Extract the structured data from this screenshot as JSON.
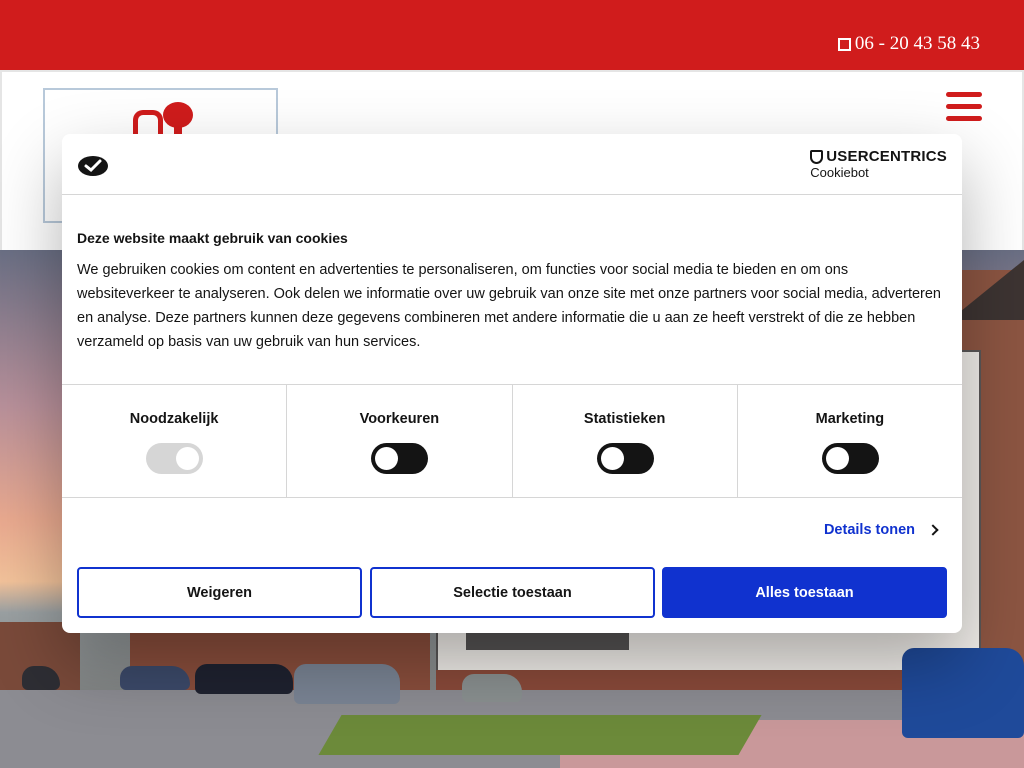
{
  "topbar": {
    "phone": "06 - 20 43 58 43",
    "brand_color": "#d01c1c"
  },
  "header": {
    "logo_icon": "lock-key-icon",
    "menu_icon": "hamburger-menu-icon"
  },
  "cookie_banner": {
    "provider_name": "USERCENTRICS",
    "provider_product": "Cookiebot",
    "title": "Deze website maakt gebruik van cookies",
    "body": "We gebruiken cookies om content en advertenties te personaliseren, om functies voor social media te bieden en om ons websiteverkeer te analyseren. Ook delen we informatie over uw gebruik van onze site met onze partners voor social media, adverteren en analyse. Deze partners kunnen deze gegevens combineren met andere informatie die u aan ze heeft verstrekt of die ze hebben verzameld op basis van uw gebruik van hun services.",
    "categories": [
      {
        "label": "Noodzakelijk",
        "enabled": true,
        "locked": true
      },
      {
        "label": "Voorkeuren",
        "enabled": false,
        "locked": false
      },
      {
        "label": "Statistieken",
        "enabled": false,
        "locked": false
      },
      {
        "label": "Marketing",
        "enabled": false,
        "locked": false
      }
    ],
    "details_link": "Details tonen",
    "buttons": {
      "reject": "Weigeren",
      "allow_selection": "Selectie toestaan",
      "allow_all": "Alles toestaan"
    },
    "accent_color": "#1032cf"
  }
}
